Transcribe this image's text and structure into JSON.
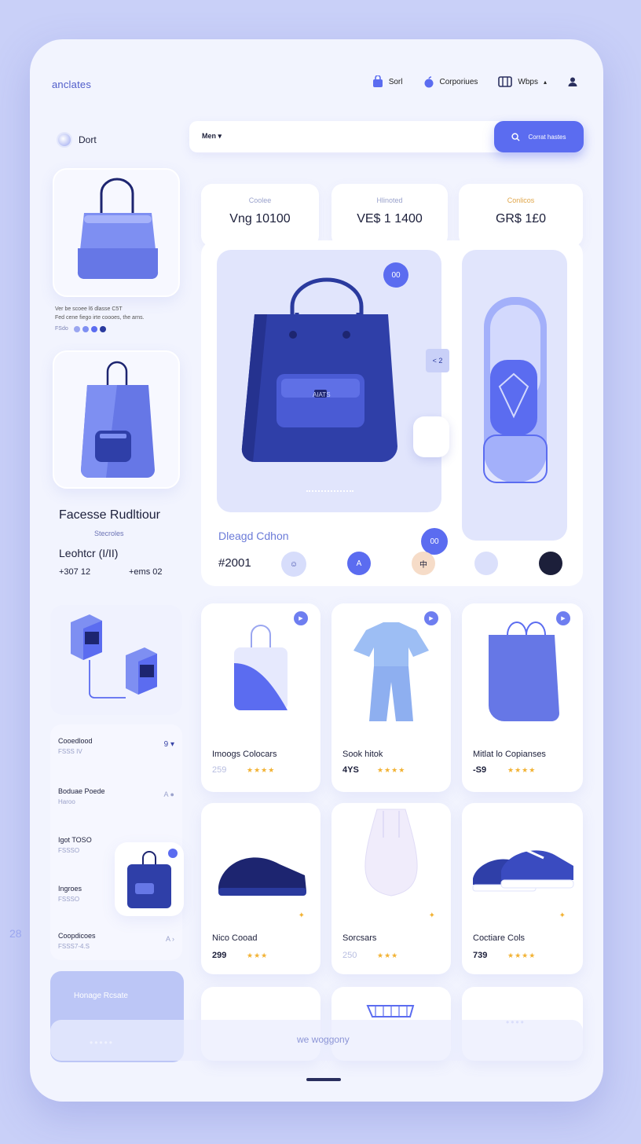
{
  "brand": "anclates",
  "nav": [
    {
      "label": "Sorl",
      "icon": "bag-icon"
    },
    {
      "label": "Corporiues",
      "icon": "apple-icon"
    },
    {
      "label": "Wbps",
      "icon": "grid-icon"
    }
  ],
  "user": {
    "label": "Dort"
  },
  "search": {
    "dropdown": "Men",
    "button": "Corrat hastes"
  },
  "sidebar": {
    "text_lines": [
      "Ver be scoee l6 dlasse C5T",
      "Fed cene fiego irte coooes, the arns."
    ],
    "dots_label": "FSdo",
    "feature_title": "Facesse Rudltiour",
    "feature_sub": "Stecroles",
    "feature_label": "Leohtcr (I/II)",
    "stat_left": "+307 12",
    "stat_right": "+ems 02"
  },
  "stats": [
    {
      "label": "Coolee",
      "value": "Vng 10100",
      "label_color": "#9aa2cc"
    },
    {
      "label": "Hlinoted",
      "value": "VE$ 1 1400",
      "label_color": "#9aa2cc"
    },
    {
      "label": "Conlicos",
      "value": "GR$ 1£0",
      "label_color": "#e0a64a"
    }
  ],
  "hero": {
    "badge": "00",
    "side_badge": "< 2",
    "pocket_text": "AIATS",
    "bottom_badge": "00",
    "collection": "Dleagd Cdhon",
    "code": "#2001",
    "swatch_a": "A",
    "swatch_b": "中"
  },
  "products": [
    {
      "name": "Imoogs Colocars",
      "price": "259",
      "stars": "★★★★",
      "icon": "tote-bag-icon"
    },
    {
      "name": "Sook hitok",
      "price": "4YS",
      "stars": "★★★★",
      "icon": "pajama-icon"
    },
    {
      "name": "Mitlat lo Copianses",
      "price": "-S9",
      "stars": "★★★★",
      "icon": "shopper-bag-icon"
    },
    {
      "name": "Nico Cooad",
      "price": "299",
      "stars": "★★★",
      "icon": "sneaker-icon"
    },
    {
      "name": "Sorcsars",
      "price": "250",
      "stars": "★★★",
      "icon": "pouch-icon"
    },
    {
      "name": "Coctiare Cols",
      "price": "739",
      "stars": "★★★★",
      "icon": "shoes-icon"
    }
  ],
  "side_list": [
    {
      "title": "Cooedlood",
      "sub": "FSSS IV",
      "aside": "9 ▾"
    },
    {
      "title": "Boduae Poede",
      "sub": "Haroo",
      "aside": "A ●"
    },
    {
      "title": "Igot TOSO",
      "sub": "FSSSO",
      "aside": ""
    },
    {
      "title": "Ingroes",
      "sub": "FSSSO",
      "aside": ""
    },
    {
      "title": "Coopdicoes",
      "sub": "FSSS7-4.S",
      "aside": "A ›"
    }
  ],
  "footer": {
    "left_label": "Honage Rcsate",
    "center_label": "we woggony",
    "left_num": "28"
  },
  "colors": {
    "accent": "#5b6cf0",
    "bg": "#f2f4fe",
    "navy": "#2a3a9e"
  }
}
